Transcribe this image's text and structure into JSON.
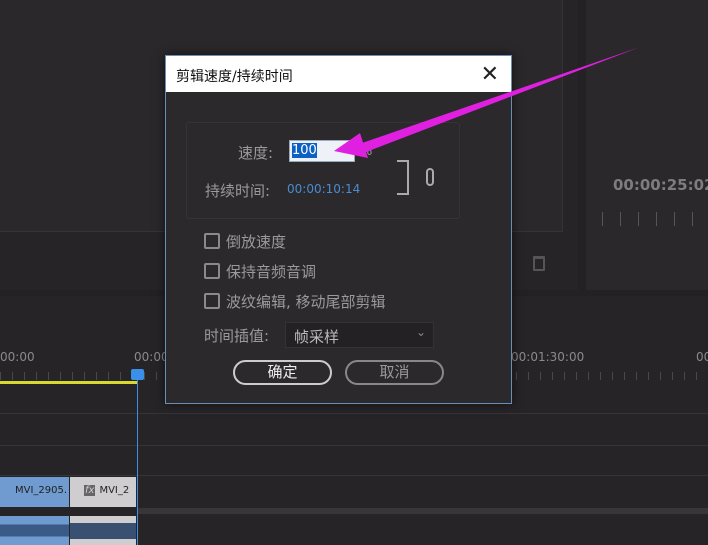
{
  "program_monitor": {
    "timecode": "00:00:25:02"
  },
  "timeline": {
    "ruler_labels": [
      "00:00",
      "00:00",
      "00:01:30:00",
      "00"
    ],
    "clips": [
      {
        "name": "MVI_2905."
      },
      {
        "name": "MVI_2"
      }
    ],
    "fx_label": "fx"
  },
  "dialog": {
    "title": "剪辑速度/持续时间",
    "speed_label": "速度:",
    "speed_value": "100",
    "speed_unit": "%",
    "duration_label": "持续时间:",
    "duration_value": "00:00:10:14",
    "checkboxes": [
      {
        "label": "倒放速度",
        "checked": false
      },
      {
        "label": "保持音频音调",
        "checked": false
      },
      {
        "label": "波纹编辑, 移动尾部剪辑",
        "checked": false
      }
    ],
    "interp_label": "时间插值:",
    "interp_value": "帧采样",
    "ok_label": "确定",
    "cancel_label": "取消"
  },
  "colors": {
    "accent": "#3d8ee0",
    "annotation_arrow": "#e020e0",
    "playhead": "#3a8fe8",
    "workarea": "#d8d830"
  }
}
